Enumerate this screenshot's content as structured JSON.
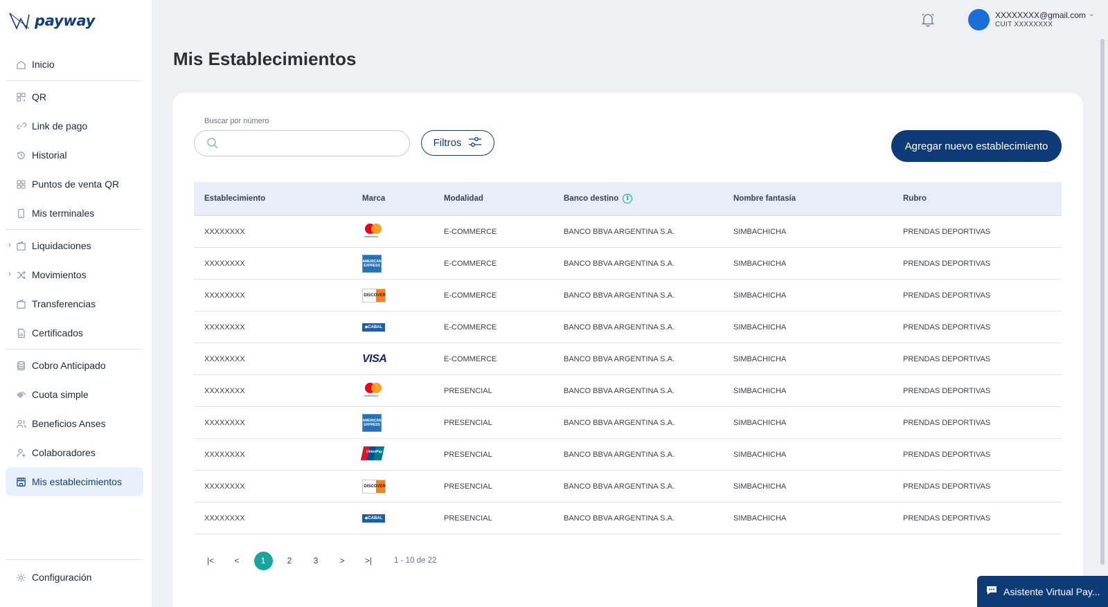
{
  "brand": {
    "name": "payway"
  },
  "sidebar": {
    "items": [
      {
        "label": "Inicio",
        "icon": "home-icon"
      },
      {
        "label": "QR",
        "icon": "qr-icon"
      },
      {
        "label": "Link de pago",
        "icon": "link-icon"
      },
      {
        "label": "Historial",
        "icon": "history-icon"
      },
      {
        "label": "Puntos de venta QR",
        "icon": "grid-icon"
      },
      {
        "label": "Mis terminales",
        "icon": "phone-icon"
      },
      {
        "label": "Liquidaciones",
        "icon": "wallet-icon"
      },
      {
        "label": "Movimientos",
        "icon": "shuffle-icon"
      },
      {
        "label": "Transferencias",
        "icon": "wallet-icon"
      },
      {
        "label": "Certificados",
        "icon": "document-icon"
      },
      {
        "label": "Cobro Anticipado",
        "icon": "database-icon"
      },
      {
        "label": "Cuota simple",
        "icon": "handshake-icon"
      },
      {
        "label": "Beneficios Anses",
        "icon": "users-icon"
      },
      {
        "label": "Colaboradores",
        "icon": "user-add-icon"
      },
      {
        "label": "Mis establecimientos",
        "icon": "store-icon"
      }
    ],
    "bottom": {
      "label": "Configuración",
      "icon": "gear-icon"
    }
  },
  "header": {
    "email": "XXXXXXXX@gmail.com",
    "cuit": "CUIT XXXXXXXX"
  },
  "page": {
    "title": "Mis Establecimientos"
  },
  "search": {
    "label": "Buscar por número",
    "value": "",
    "placeholder": ""
  },
  "filters": {
    "label": "Filtros"
  },
  "add_button": {
    "label": "Agregar nuevo establecimiento"
  },
  "table": {
    "headers": [
      "Establecimiento",
      "Marca",
      "Modalidad",
      "Banco destino",
      "Nombre fantasía",
      "Rubro"
    ],
    "rows": [
      {
        "establecimiento": "XXXXXXXX",
        "marca": "mastercard",
        "modalidad": "E-COMMERCE",
        "banco": "BANCO BBVA ARGENTINA S.A.",
        "nombre": "SIMBACHICHA",
        "rubro": "PRENDAS DEPORTIVAS"
      },
      {
        "establecimiento": "XXXXXXXX",
        "marca": "amex",
        "modalidad": "E-COMMERCE",
        "banco": "BANCO BBVA ARGENTINA S.A.",
        "nombre": "SIMBACHICHA",
        "rubro": "PRENDAS DEPORTIVAS"
      },
      {
        "establecimiento": "XXXXXXXX",
        "marca": "discover",
        "modalidad": "E-COMMERCE",
        "banco": "BANCO BBVA ARGENTINA S.A.",
        "nombre": "SIMBACHICHA",
        "rubro": "PRENDAS DEPORTIVAS"
      },
      {
        "establecimiento": "XXXXXXXX",
        "marca": "cabal",
        "modalidad": "E-COMMERCE",
        "banco": "BANCO BBVA ARGENTINA S.A.",
        "nombre": "SIMBACHICHA",
        "rubro": "PRENDAS DEPORTIVAS"
      },
      {
        "establecimiento": "XXXXXXXX",
        "marca": "visa",
        "modalidad": "E-COMMERCE",
        "banco": "BANCO BBVA ARGENTINA S.A.",
        "nombre": "SIMBACHICHA",
        "rubro": "PRENDAS DEPORTIVAS"
      },
      {
        "establecimiento": "XXXXXXXX",
        "marca": "mastercard",
        "modalidad": "PRESENCIAL",
        "banco": "BANCO BBVA ARGENTINA S.A.",
        "nombre": "SIMBACHICHA",
        "rubro": "PRENDAS DEPORTIVAS"
      },
      {
        "establecimiento": "XXXXXXXX",
        "marca": "amex",
        "modalidad": "PRESENCIAL",
        "banco": "BANCO BBVA ARGENTINA S.A.",
        "nombre": "SIMBACHICHA",
        "rubro": "PRENDAS DEPORTIVAS"
      },
      {
        "establecimiento": "XXXXXXXX",
        "marca": "unionpay",
        "modalidad": "PRESENCIAL",
        "banco": "BANCO BBVA ARGENTINA S.A.",
        "nombre": "SIMBACHICHA",
        "rubro": "PRENDAS DEPORTIVAS"
      },
      {
        "establecimiento": "XXXXXXXX",
        "marca": "discover",
        "modalidad": "PRESENCIAL",
        "banco": "BANCO BBVA ARGENTINA S.A.",
        "nombre": "SIMBACHICHA",
        "rubro": "PRENDAS DEPORTIVAS"
      },
      {
        "establecimiento": "XXXXXXXX",
        "marca": "cabal",
        "modalidad": "PRESENCIAL",
        "banco": "BANCO BBVA ARGENTINA S.A.",
        "nombre": "SIMBACHICHA",
        "rubro": "PRENDAS DEPORTIVAS"
      }
    ]
  },
  "pagination": {
    "first": "|<",
    "prev": "<",
    "next": ">",
    "last": ">|",
    "pages": [
      "1",
      "2",
      "3"
    ],
    "current": "1",
    "info": "1 - 10 de 22"
  },
  "chat": {
    "label": "Asistente Virtual Pay..."
  },
  "colors": {
    "primary": "#0f3a78",
    "accent": "#19a59b",
    "active_bg": "#e8f0fb",
    "avatar": "#1a6fd6"
  }
}
